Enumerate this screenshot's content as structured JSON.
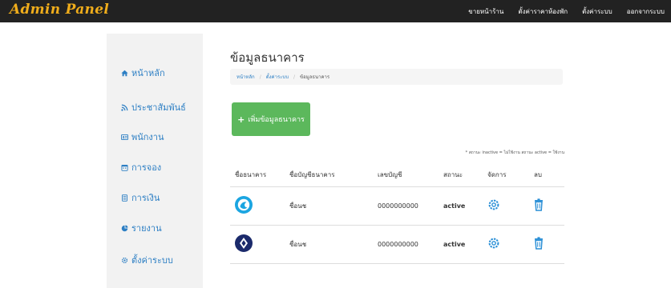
{
  "app": {
    "brand": "Admin Panel",
    "nav": [
      "ขายหน้าร้าน",
      "ตั้งค่าราคาห้องพัก",
      "ตั้งค่าระบบ",
      "ออกจากระบบ"
    ]
  },
  "sidebar": {
    "items": [
      {
        "label": "หน้าหลัก",
        "icon": "home-icon"
      },
      {
        "label": "ประชาสัมพันธ์",
        "icon": "rss-icon"
      },
      {
        "label": "พนักงาน",
        "icon": "id-card-icon"
      },
      {
        "label": "การจอง",
        "icon": "calendar-icon"
      },
      {
        "label": "การเงิน",
        "icon": "money-icon"
      },
      {
        "label": "รายงาน",
        "icon": "chart-icon"
      },
      {
        "label": "ตั้งค่าระบบ",
        "icon": "gear-icon"
      }
    ]
  },
  "page": {
    "title": "ข้อมูลธนาคาร",
    "breadcrumb": [
      "หน้าหลัก",
      "ตั้งค่าระบบ",
      "ข้อมูลธนาคาร"
    ],
    "add_button": "เพิ่มข้อมูลธนาคาร",
    "note": "* สถานะ inactive = ไม่ใช้งาน สถานะ active = ใช้งาน"
  },
  "table": {
    "headers": [
      "ชื่อธนาคาร",
      "ชื่อบัญชีธนาคาร",
      "เลขบัญชี",
      "สถานะ",
      "จัดการ",
      "ลบ"
    ],
    "rows": [
      {
        "bank_icon": "krungthai-bank-logo",
        "bank_color": "#1ba5e1",
        "account_name": "ชื่อนช",
        "account_no": "0000000000",
        "status": "active"
      },
      {
        "bank_icon": "tmb-bank-logo",
        "bank_color": "#1b2a6b",
        "account_name": "ชื่อนช",
        "account_no": "0000000000",
        "status": "active"
      }
    ]
  },
  "colors": {
    "navbar": "#222222",
    "brand": "#f0ad1b",
    "link": "#2d7fc4",
    "add_button": "#5cb85c",
    "status_active": "#3c9a3c",
    "action_icon": "#2a8fd6"
  }
}
